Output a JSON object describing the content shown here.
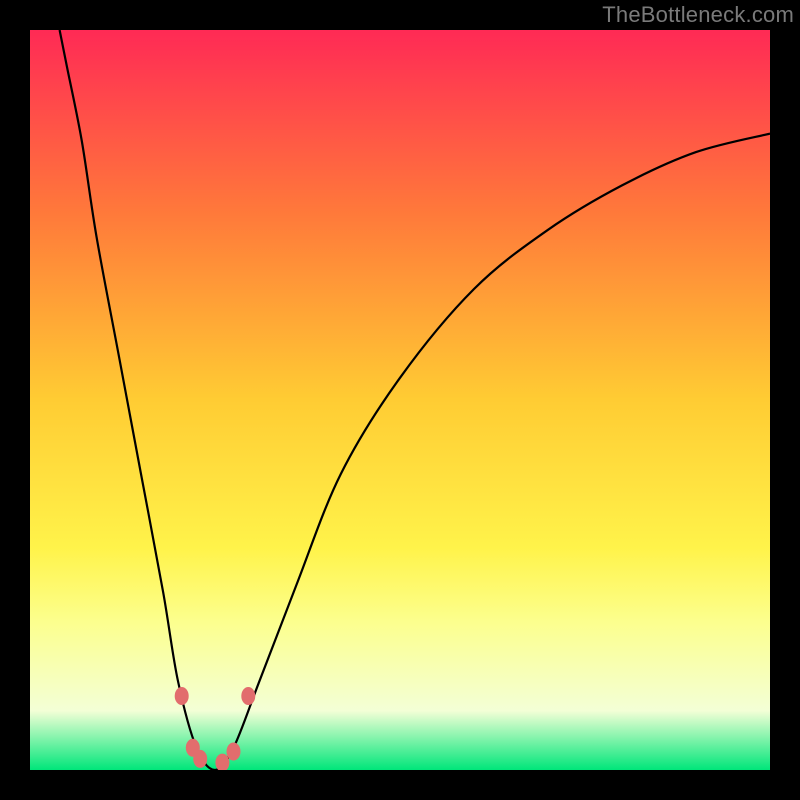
{
  "watermark": "TheBottleneck.com",
  "chart_data": {
    "type": "line",
    "title": "",
    "xlabel": "",
    "ylabel": "",
    "xlim": [
      0,
      100
    ],
    "ylim": [
      0,
      100
    ],
    "background_gradient_stops": [
      {
        "offset": 0.0,
        "color": "#ff2a55"
      },
      {
        "offset": 0.25,
        "color": "#ff7a3a"
      },
      {
        "offset": 0.5,
        "color": "#ffcc33"
      },
      {
        "offset": 0.7,
        "color": "#fff34a"
      },
      {
        "offset": 0.8,
        "color": "#fcff8e"
      },
      {
        "offset": 0.92,
        "color": "#f3ffd6"
      },
      {
        "offset": 1.0,
        "color": "#00e67a"
      }
    ],
    "curve_notch_x": 25,
    "curve_points": [
      {
        "x": 4.0,
        "y": 100.0
      },
      {
        "x": 5.0,
        "y": 95.0
      },
      {
        "x": 7.0,
        "y": 85.0
      },
      {
        "x": 9.0,
        "y": 72.0
      },
      {
        "x": 12.0,
        "y": 56.0
      },
      {
        "x": 15.0,
        "y": 40.0
      },
      {
        "x": 18.0,
        "y": 24.0
      },
      {
        "x": 20.0,
        "y": 12.0
      },
      {
        "x": 22.5,
        "y": 3.0
      },
      {
        "x": 25.0,
        "y": 0.0
      },
      {
        "x": 27.5,
        "y": 3.0
      },
      {
        "x": 31.0,
        "y": 12.0
      },
      {
        "x": 36.0,
        "y": 25.0
      },
      {
        "x": 42.0,
        "y": 40.0
      },
      {
        "x": 50.0,
        "y": 53.0
      },
      {
        "x": 60.0,
        "y": 65.0
      },
      {
        "x": 70.0,
        "y": 73.0
      },
      {
        "x": 80.0,
        "y": 79.0
      },
      {
        "x": 90.0,
        "y": 83.5
      },
      {
        "x": 100.0,
        "y": 86.0
      }
    ],
    "markers": [
      {
        "x": 20.5,
        "y": 10.0
      },
      {
        "x": 22.0,
        "y": 3.0
      },
      {
        "x": 23.0,
        "y": 1.5
      },
      {
        "x": 26.0,
        "y": 1.0
      },
      {
        "x": 27.5,
        "y": 2.5
      },
      {
        "x": 29.5,
        "y": 10.0
      }
    ],
    "marker_color": "#e26d6d",
    "curve_color": "#000000"
  }
}
